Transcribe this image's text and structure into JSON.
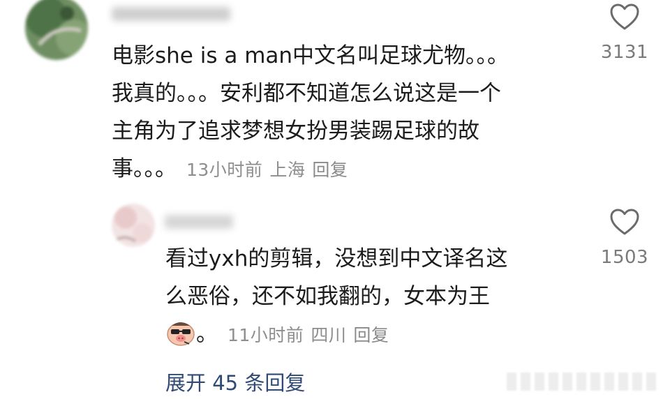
{
  "comments": [
    {
      "text": "电影she is a man中文名叫足球尤物。。。\n我真的。。。安利都不知道怎么说这是一个\n主角为了追求梦想女扮男装踢足球的故\n事。。。",
      "time": "13小时前",
      "location": "上海",
      "reply_label": "回复",
      "likes": "3131",
      "icons": {
        "like": "heart-outline-icon"
      }
    },
    {
      "text": "看过yxh的剪辑，没想到中文译名这\n么恶俗，还不如我翻的，女本为王\n",
      "emoji_trailer": "。",
      "time": "11小时前",
      "location": "四川",
      "reply_label": "回复",
      "likes": "1503",
      "icons": {
        "like": "heart-outline-icon",
        "emoji": "cool-pig-emoji-icon"
      }
    }
  ],
  "expand_replies": "展开 45 条回复",
  "colors": {
    "text": "#1c1c1c",
    "meta": "#8e8e8e",
    "link": "#2f4a74",
    "icon": "#7a7a7a"
  }
}
